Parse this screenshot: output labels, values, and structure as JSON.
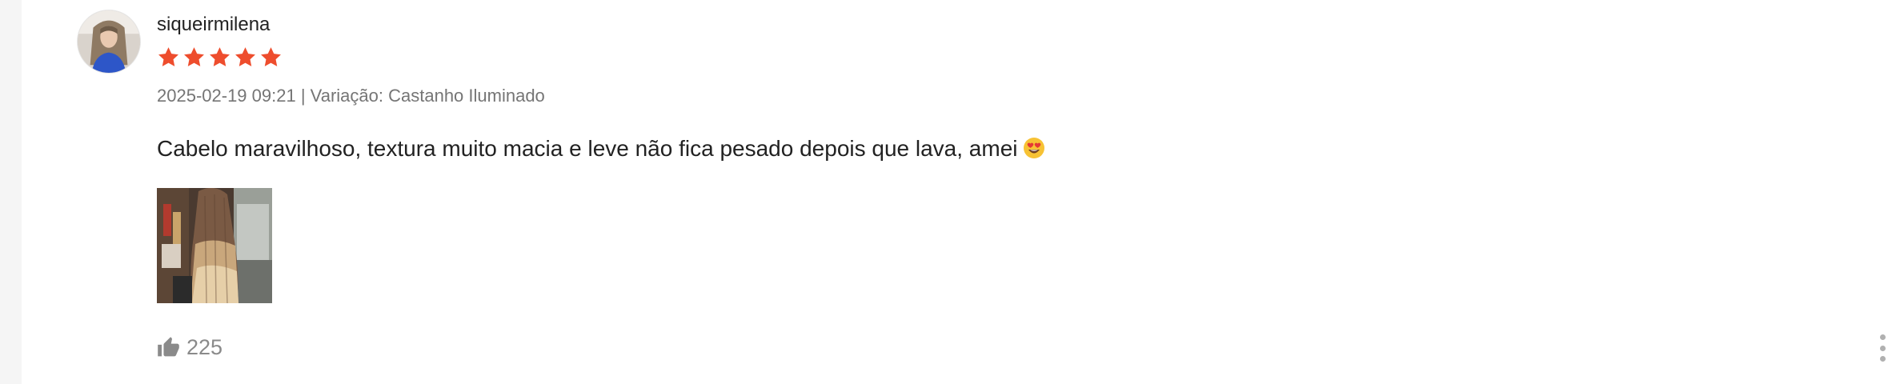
{
  "review": {
    "username": "siqueirmilena",
    "rating": 5,
    "rating_max": 5,
    "datetime": "2025-02-19 09:21",
    "separator": "|",
    "variation_label": "Variação:",
    "variation_value": "Castanho Iluminado",
    "comment": "Cabelo maravilhoso, textura muito macia e leve não fica pesado depois que lava, amei",
    "comment_emoji": "smiling-face-with-heart-eyes",
    "media_count": 1,
    "likes": "225"
  },
  "colors": {
    "star": "#ee4d2d",
    "text_primary": "#222222",
    "text_secondary": "#757575",
    "like": "#8a8a8a",
    "more_dots": "#b0b0b0",
    "page_bg": "#f5f5f5",
    "card_bg": "#ffffff"
  },
  "icons": {
    "star": "star-icon",
    "like": "thumbs-up-icon",
    "more": "more-vertical-icon"
  }
}
